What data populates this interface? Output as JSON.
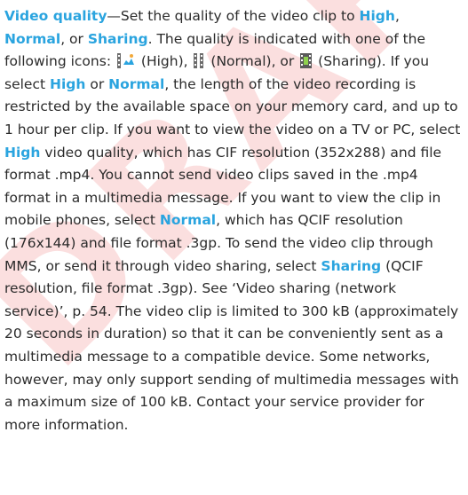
{
  "watermark": "DRAFT",
  "accent_color": "#2aa4df",
  "text_color": "#2b2b2b",
  "icons": {
    "high": "video-quality-high-icon",
    "normal": "video-quality-normal-icon",
    "sharing": "video-quality-sharing-icon"
  },
  "para": {
    "t_title": "Video quality",
    "t_s01": "—Set the quality of the video clip to ",
    "t_high1": "High",
    "t_s02": ", ",
    "t_normal1": "Normal",
    "t_s03": ", or ",
    "t_sharing1": "Sharing",
    "t_s04": ". The quality is indicated with one of the following icons: ",
    "t_s05": " (High), ",
    "t_s06": " (Normal), or ",
    "t_s07": " (Sharing). If you select ",
    "t_high2": "High",
    "t_s08": " or ",
    "t_normal2": "Normal",
    "t_s09": ", the length of the video recording is restricted by the available space on your memory card, and up to 1 hour per clip. If you want to view the video on a TV or PC, select ",
    "t_high3": "High",
    "t_s10": " video quality, which has CIF resolution (352x288) and file format .mp4. You cannot send video clips saved in the .mp4 format in a multimedia message. If you want to view the clip in mobile phones, select ",
    "t_normal3": "Normal",
    "t_s11": ", which has QCIF resolution (176x144) and file format .3gp. To send the video clip through MMS, or send it through video sharing, select ",
    "t_sharing2": "Sharing",
    "t_s12": " (QCIF resolution, file format .3gp). See ‘Video sharing (network service)’, p. 54. The video clip is limited to 300 kB (approximately 20 seconds in duration) so that it can be conveniently sent as a multimedia message to a compatible device. Some networks, however, may only support sending of multimedia messages with a maximum size of 100 kB. Contact your service provider for more information."
  }
}
